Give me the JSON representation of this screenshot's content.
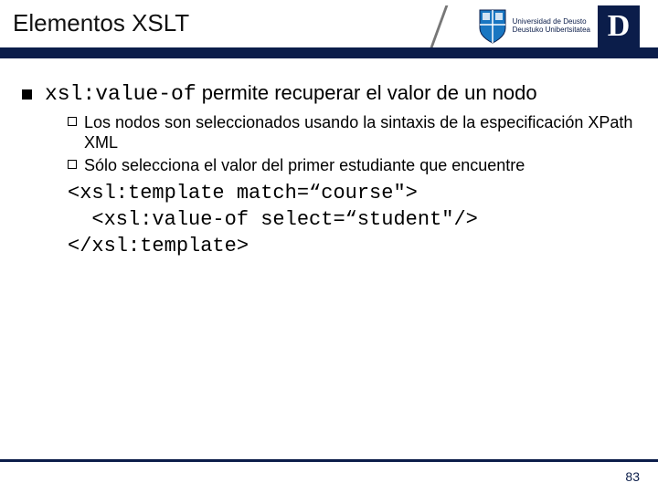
{
  "header": {
    "title": "Elementos XSLT",
    "university_line1": "Universidad de Deusto",
    "university_line2": "Deustuko Unibertsitatea"
  },
  "main": {
    "code_term": "xsl:value-of",
    "lead_rest": " permite recuperar el valor de un nodo",
    "sub": [
      "Los nodos son seleccionados usando la sintaxis de la especificación XPath XML",
      "Sólo selecciona el valor del primer estudiante que encuentre"
    ],
    "code": "<xsl:template match=“course\">\n  <xsl:value-of select=“student\"/>\n</xsl:template>"
  },
  "footer": {
    "page": "83"
  }
}
